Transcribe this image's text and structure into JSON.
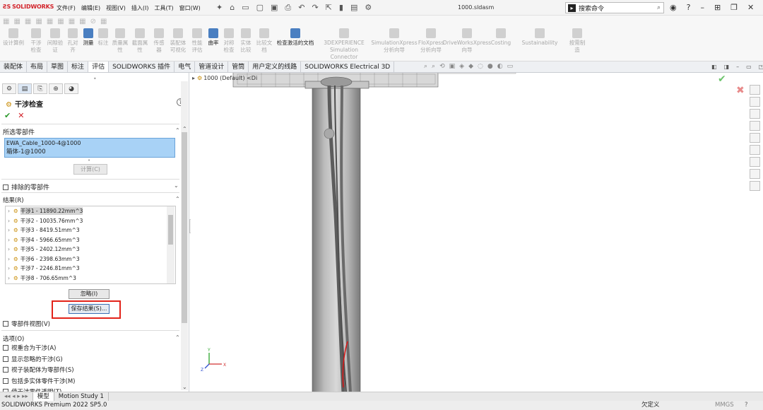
{
  "app": {
    "logo_text": "SOLIDWORKS",
    "doc_title": "1000.sldasm"
  },
  "menu": [
    "文件(F)",
    "编辑(E)",
    "视图(V)",
    "插入(I)",
    "工具(T)",
    "窗口(W)"
  ],
  "search": {
    "placeholder": "搜索命令"
  },
  "ribbon": [
    {
      "label": "设计算例"
    },
    {
      "label": "干涉检查"
    },
    {
      "label": "间隙验证"
    },
    {
      "label": "孔对齐"
    },
    {
      "label": "测量",
      "active": true
    },
    {
      "label": "标注"
    },
    {
      "label": "质量属性"
    },
    {
      "label": "截面属性"
    },
    {
      "label": "传感器"
    },
    {
      "label": "装配体可视化"
    },
    {
      "label": "性能评估"
    },
    {
      "label": "曲率",
      "active": true
    },
    {
      "label": "对称检查"
    },
    {
      "label": "实体比较"
    },
    {
      "label": "比较文档"
    },
    {
      "label": "检查激活的文档",
      "active": true
    },
    {
      "label": "3DEXPERIENCE Simulation Connector"
    },
    {
      "label": "SimulationXpress 分析向导"
    },
    {
      "label": "FloXpress 分析向导"
    },
    {
      "label": "DriveWorksXpress 向导"
    },
    {
      "label": "Costing"
    },
    {
      "label": "Sustainability"
    },
    {
      "label": "按需制造"
    }
  ],
  "tabs": [
    "装配体",
    "布局",
    "草图",
    "标注",
    "评估",
    "SOLIDWORKS 插件",
    "电气",
    "管道设计",
    "管筒",
    "用户定义的线路",
    "SOLIDWORKS Electrical 3D"
  ],
  "active_tab": "评估",
  "panel": {
    "title": "干涉检查",
    "selected_label": "所选零部件",
    "selected": [
      "EWA_Cable_1000-4@1000",
      "箱体-1@1000"
    ],
    "calc_button": "计算(C)",
    "excluded_label": "排除的零部件",
    "results_label": "结果(R)",
    "results": [
      "干涉1 - 11890.22mm^3",
      "干涉2 - 10035.76mm^3",
      "干涉3 - 8419.51mm^3",
      "干涉4 - 5966.65mm^3",
      "干涉5 - 2402.12mm^3",
      "干涉6 - 2398.63mm^3",
      "干涉7 - 2246.81mm^3",
      "干涉8 - 706.65mm^3"
    ],
    "ignore_button": "忽略(I)",
    "save_button": "保存结果(S)...",
    "component_view": "零部件视图(V)",
    "options_label": "选项(O)",
    "options": [
      "视重合为干涉(A)",
      "显示忽略的干涉(G)",
      "视子装配体为零部件(S)",
      "包括多实体零件干涉(M)",
      "使干涉零件透明(T)"
    ]
  },
  "viewport": {
    "tree_label": "1000 (Default) <Di"
  },
  "bottom_tabs": [
    "模型",
    "Motion Study 1"
  ],
  "status": {
    "left": "SOLIDWORKS Premium 2022 SP5.0",
    "custom": "欠定义",
    "units": "MMGS"
  }
}
